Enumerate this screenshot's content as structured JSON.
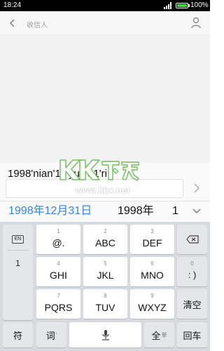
{
  "status_bar": {
    "time": "18:24",
    "battery": "100%",
    "battery_level": 1.0
  },
  "header": {
    "title": "收信人"
  },
  "compose": {
    "input_text": "1998'nian'12'yue'31'ri"
  },
  "watermark": {
    "logo_text": "KK下载",
    "url": "www.kkx.net"
  },
  "candidates": [
    "1998年12月31日",
    "1998年",
    "1"
  ],
  "keyboard": {
    "side": {
      "en": "EN",
      "digit": "1"
    },
    "rows": [
      [
        {
          "num": "1",
          "letters": "@."
        },
        {
          "num": "2",
          "letters": "ABC"
        },
        {
          "num": "3",
          "letters": "DEF"
        }
      ],
      [
        {
          "num": "4",
          "letters": "GHI"
        },
        {
          "num": "5",
          "letters": "JKL"
        },
        {
          "num": "6",
          "letters": "MNO"
        }
      ],
      [
        {
          "num": "7",
          "letters": "PQRS"
        },
        {
          "num": "8",
          "letters": "TUV"
        },
        {
          "num": "9",
          "letters": "WXYZ"
        }
      ]
    ],
    "right": {
      "num0": "0",
      "paren": ": )",
      "clear": "清空"
    },
    "bottom": {
      "symbols": "符",
      "words": "词",
      "words_sup": "'",
      "full": "全",
      "full_sub": "单",
      "enter": "回车"
    }
  }
}
